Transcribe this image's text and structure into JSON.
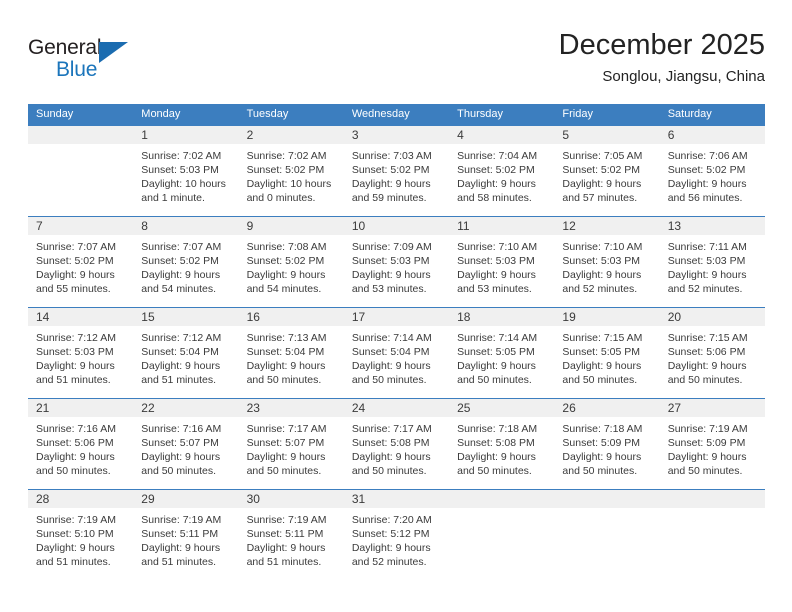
{
  "brand": {
    "word_top": "General",
    "word_bottom": "Blue",
    "triangle_color": "#1b6cb0",
    "blue_color": "#1b75bb"
  },
  "header": {
    "title": "December 2025",
    "subtitle": "Songlou, Jiangsu, China"
  },
  "theme": {
    "header_blue": "#3c7ebf",
    "daynum_band": "#f0f0f0",
    "text": "#3b3b3b"
  },
  "weekdays": [
    "Sunday",
    "Monday",
    "Tuesday",
    "Wednesday",
    "Thursday",
    "Friday",
    "Saturday"
  ],
  "weeks": [
    {
      "days": [
        {
          "num": "",
          "sunrise": "",
          "sunset": "",
          "daylight_l1": "",
          "daylight_l2": ""
        },
        {
          "num": "1",
          "sunrise": "Sunrise: 7:02 AM",
          "sunset": "Sunset: 5:03 PM",
          "daylight_l1": "Daylight: 10 hours",
          "daylight_l2": "and 1 minute."
        },
        {
          "num": "2",
          "sunrise": "Sunrise: 7:02 AM",
          "sunset": "Sunset: 5:02 PM",
          "daylight_l1": "Daylight: 10 hours",
          "daylight_l2": "and 0 minutes."
        },
        {
          "num": "3",
          "sunrise": "Sunrise: 7:03 AM",
          "sunset": "Sunset: 5:02 PM",
          "daylight_l1": "Daylight: 9 hours",
          "daylight_l2": "and 59 minutes."
        },
        {
          "num": "4",
          "sunrise": "Sunrise: 7:04 AM",
          "sunset": "Sunset: 5:02 PM",
          "daylight_l1": "Daylight: 9 hours",
          "daylight_l2": "and 58 minutes."
        },
        {
          "num": "5",
          "sunrise": "Sunrise: 7:05 AM",
          "sunset": "Sunset: 5:02 PM",
          "daylight_l1": "Daylight: 9 hours",
          "daylight_l2": "and 57 minutes."
        },
        {
          "num": "6",
          "sunrise": "Sunrise: 7:06 AM",
          "sunset": "Sunset: 5:02 PM",
          "daylight_l1": "Daylight: 9 hours",
          "daylight_l2": "and 56 minutes."
        }
      ]
    },
    {
      "days": [
        {
          "num": "7",
          "sunrise": "Sunrise: 7:07 AM",
          "sunset": "Sunset: 5:02 PM",
          "daylight_l1": "Daylight: 9 hours",
          "daylight_l2": "and 55 minutes."
        },
        {
          "num": "8",
          "sunrise": "Sunrise: 7:07 AM",
          "sunset": "Sunset: 5:02 PM",
          "daylight_l1": "Daylight: 9 hours",
          "daylight_l2": "and 54 minutes."
        },
        {
          "num": "9",
          "sunrise": "Sunrise: 7:08 AM",
          "sunset": "Sunset: 5:02 PM",
          "daylight_l1": "Daylight: 9 hours",
          "daylight_l2": "and 54 minutes."
        },
        {
          "num": "10",
          "sunrise": "Sunrise: 7:09 AM",
          "sunset": "Sunset: 5:03 PM",
          "daylight_l1": "Daylight: 9 hours",
          "daylight_l2": "and 53 minutes."
        },
        {
          "num": "11",
          "sunrise": "Sunrise: 7:10 AM",
          "sunset": "Sunset: 5:03 PM",
          "daylight_l1": "Daylight: 9 hours",
          "daylight_l2": "and 53 minutes."
        },
        {
          "num": "12",
          "sunrise": "Sunrise: 7:10 AM",
          "sunset": "Sunset: 5:03 PM",
          "daylight_l1": "Daylight: 9 hours",
          "daylight_l2": "and 52 minutes."
        },
        {
          "num": "13",
          "sunrise": "Sunrise: 7:11 AM",
          "sunset": "Sunset: 5:03 PM",
          "daylight_l1": "Daylight: 9 hours",
          "daylight_l2": "and 52 minutes."
        }
      ]
    },
    {
      "days": [
        {
          "num": "14",
          "sunrise": "Sunrise: 7:12 AM",
          "sunset": "Sunset: 5:03 PM",
          "daylight_l1": "Daylight: 9 hours",
          "daylight_l2": "and 51 minutes."
        },
        {
          "num": "15",
          "sunrise": "Sunrise: 7:12 AM",
          "sunset": "Sunset: 5:04 PM",
          "daylight_l1": "Daylight: 9 hours",
          "daylight_l2": "and 51 minutes."
        },
        {
          "num": "16",
          "sunrise": "Sunrise: 7:13 AM",
          "sunset": "Sunset: 5:04 PM",
          "daylight_l1": "Daylight: 9 hours",
          "daylight_l2": "and 50 minutes."
        },
        {
          "num": "17",
          "sunrise": "Sunrise: 7:14 AM",
          "sunset": "Sunset: 5:04 PM",
          "daylight_l1": "Daylight: 9 hours",
          "daylight_l2": "and 50 minutes."
        },
        {
          "num": "18",
          "sunrise": "Sunrise: 7:14 AM",
          "sunset": "Sunset: 5:05 PM",
          "daylight_l1": "Daylight: 9 hours",
          "daylight_l2": "and 50 minutes."
        },
        {
          "num": "19",
          "sunrise": "Sunrise: 7:15 AM",
          "sunset": "Sunset: 5:05 PM",
          "daylight_l1": "Daylight: 9 hours",
          "daylight_l2": "and 50 minutes."
        },
        {
          "num": "20",
          "sunrise": "Sunrise: 7:15 AM",
          "sunset": "Sunset: 5:06 PM",
          "daylight_l1": "Daylight: 9 hours",
          "daylight_l2": "and 50 minutes."
        }
      ]
    },
    {
      "days": [
        {
          "num": "21",
          "sunrise": "Sunrise: 7:16 AM",
          "sunset": "Sunset: 5:06 PM",
          "daylight_l1": "Daylight: 9 hours",
          "daylight_l2": "and 50 minutes."
        },
        {
          "num": "22",
          "sunrise": "Sunrise: 7:16 AM",
          "sunset": "Sunset: 5:07 PM",
          "daylight_l1": "Daylight: 9 hours",
          "daylight_l2": "and 50 minutes."
        },
        {
          "num": "23",
          "sunrise": "Sunrise: 7:17 AM",
          "sunset": "Sunset: 5:07 PM",
          "daylight_l1": "Daylight: 9 hours",
          "daylight_l2": "and 50 minutes."
        },
        {
          "num": "24",
          "sunrise": "Sunrise: 7:17 AM",
          "sunset": "Sunset: 5:08 PM",
          "daylight_l1": "Daylight: 9 hours",
          "daylight_l2": "and 50 minutes."
        },
        {
          "num": "25",
          "sunrise": "Sunrise: 7:18 AM",
          "sunset": "Sunset: 5:08 PM",
          "daylight_l1": "Daylight: 9 hours",
          "daylight_l2": "and 50 minutes."
        },
        {
          "num": "26",
          "sunrise": "Sunrise: 7:18 AM",
          "sunset": "Sunset: 5:09 PM",
          "daylight_l1": "Daylight: 9 hours",
          "daylight_l2": "and 50 minutes."
        },
        {
          "num": "27",
          "sunrise": "Sunrise: 7:19 AM",
          "sunset": "Sunset: 5:09 PM",
          "daylight_l1": "Daylight: 9 hours",
          "daylight_l2": "and 50 minutes."
        }
      ]
    },
    {
      "days": [
        {
          "num": "28",
          "sunrise": "Sunrise: 7:19 AM",
          "sunset": "Sunset: 5:10 PM",
          "daylight_l1": "Daylight: 9 hours",
          "daylight_l2": "and 51 minutes."
        },
        {
          "num": "29",
          "sunrise": "Sunrise: 7:19 AM",
          "sunset": "Sunset: 5:11 PM",
          "daylight_l1": "Daylight: 9 hours",
          "daylight_l2": "and 51 minutes."
        },
        {
          "num": "30",
          "sunrise": "Sunrise: 7:19 AM",
          "sunset": "Sunset: 5:11 PM",
          "daylight_l1": "Daylight: 9 hours",
          "daylight_l2": "and 51 minutes."
        },
        {
          "num": "31",
          "sunrise": "Sunrise: 7:20 AM",
          "sunset": "Sunset: 5:12 PM",
          "daylight_l1": "Daylight: 9 hours",
          "daylight_l2": "and 52 minutes."
        },
        {
          "num": "",
          "sunrise": "",
          "sunset": "",
          "daylight_l1": "",
          "daylight_l2": ""
        },
        {
          "num": "",
          "sunrise": "",
          "sunset": "",
          "daylight_l1": "",
          "daylight_l2": ""
        },
        {
          "num": "",
          "sunrise": "",
          "sunset": "",
          "daylight_l1": "",
          "daylight_l2": ""
        }
      ]
    }
  ]
}
